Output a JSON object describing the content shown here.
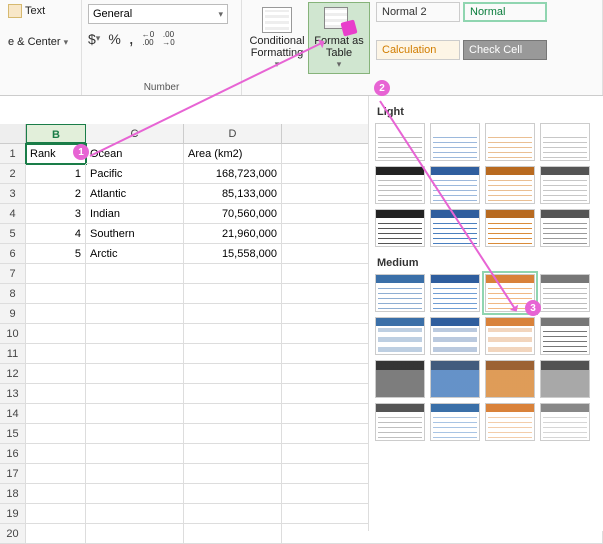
{
  "ribbon": {
    "wrap_text": "Text",
    "merge_center": "e & Center",
    "number_format": "General",
    "number_group_label": "Number",
    "currency": "$",
    "percent": "%",
    "comma": ",",
    "inc_dec_a": "←0\n.00",
    "inc_dec_b": ".00\n→0",
    "conditional_formatting": "Conditional\nFormatting",
    "format_as_table": "Format as\nTable",
    "styles": {
      "normal2": "Normal 2",
      "normal": "Normal",
      "calculation": "Calculation",
      "check_cell": "Check Cell"
    }
  },
  "sheet": {
    "columns": [
      "B",
      "C",
      "D"
    ],
    "header_row": {
      "B": "Rank",
      "C": "Ocean",
      "D": "Area (km2)"
    },
    "rows": [
      {
        "B": "1",
        "C": "Pacific",
        "D": "168,723,000"
      },
      {
        "B": "2",
        "C": "Atlantic",
        "D": "85,133,000"
      },
      {
        "B": "3",
        "C": "Indian",
        "D": "70,560,000"
      },
      {
        "B": "4",
        "C": "Southern",
        "D": "21,960,000"
      },
      {
        "B": "5",
        "C": "Arctic",
        "D": "15,558,000"
      }
    ],
    "selected_cell": "B1"
  },
  "gallery": {
    "section_light": "Light",
    "section_medium": "Medium",
    "light_palettes": [
      {
        "hdr": "transparent",
        "body": "#888"
      },
      {
        "hdr": "transparent",
        "body": "#4a7fbf"
      },
      {
        "hdr": "transparent",
        "body": "#d98b3a"
      },
      {
        "hdr": "transparent",
        "body": "#999"
      },
      {
        "hdr": "#222",
        "body": "#888"
      },
      {
        "hdr": "#2f5e9e",
        "body": "#4a7fbf"
      },
      {
        "hdr": "#b86a20",
        "body": "#d98b3a"
      },
      {
        "hdr": "#555",
        "body": "#999"
      },
      {
        "hdr": "#222",
        "body": "#555",
        "grid": true
      },
      {
        "hdr": "#2f5e9e",
        "body": "#4a7fbf",
        "grid": true
      },
      {
        "hdr": "#b86a20",
        "body": "#d98b3a",
        "grid": true
      },
      {
        "hdr": "#555",
        "body": "#999",
        "grid": true
      }
    ],
    "medium_palettes": [
      {
        "hdr": "#3a6fa8",
        "body": "#8faed2",
        "sel": false
      },
      {
        "hdr": "#2f5e9e",
        "body": "#6f9dd4",
        "sel": false
      },
      {
        "hdr": "#d9823a",
        "body": "#f0b884",
        "sel": true
      },
      {
        "hdr": "#777",
        "body": "#bcbcbc",
        "sel": false
      },
      {
        "hdr": "#3a6fa8",
        "body": "#3a6fa8",
        "band": true
      },
      {
        "hdr": "#2f5e9e",
        "body": "#2f5e9e",
        "band": true
      },
      {
        "hdr": "#d9823a",
        "body": "#d9823a",
        "band": true
      },
      {
        "hdr": "#777",
        "body": "#777",
        "band": true
      },
      {
        "hdr": "#111",
        "body": "#666",
        "dark": true
      },
      {
        "hdr": "#203e66",
        "body": "#4a7fbf",
        "dark": true
      },
      {
        "hdr": "#8a4610",
        "body": "#d98b3a",
        "dark": true
      },
      {
        "hdr": "#333",
        "body": "#999",
        "dark": true
      },
      {
        "hdr": "#555",
        "body": "#bfbfbf"
      },
      {
        "hdr": "#3a6fa8",
        "body": "#a8c4e4"
      },
      {
        "hdr": "#d9823a",
        "body": "#f3cdaa"
      },
      {
        "hdr": "#888",
        "body": "#d6d6d6"
      }
    ]
  },
  "badges": {
    "b1": "1",
    "b2": "2",
    "b3": "3"
  }
}
